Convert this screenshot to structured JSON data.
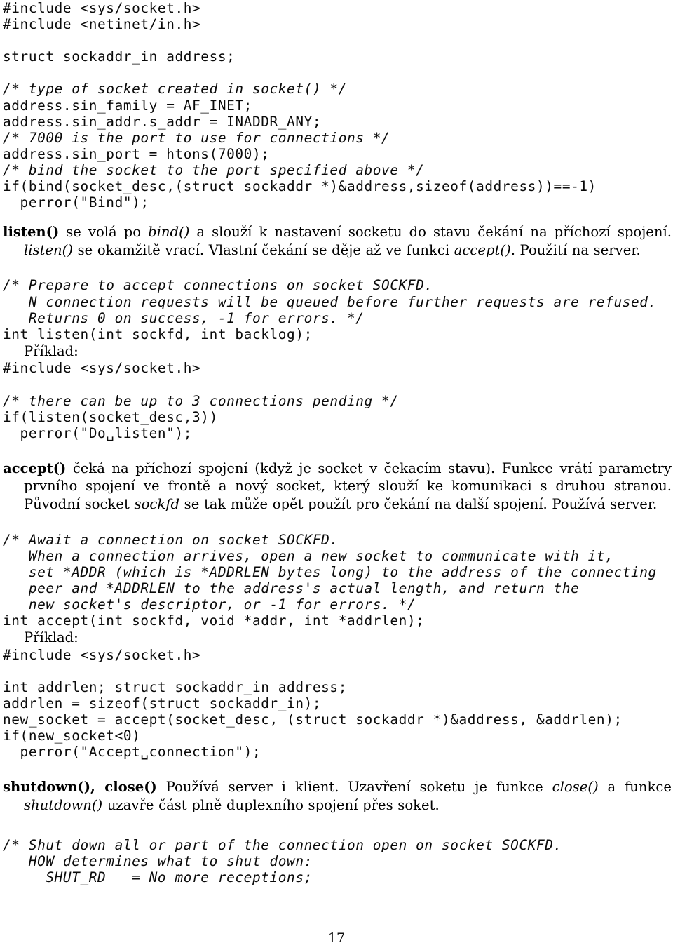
{
  "document": {
    "language": "cs",
    "page_number": "17",
    "topic": "Socket API — listen(), accept(), shutdown(), close()"
  },
  "blocks": {
    "code_bind": {
      "lines": [
        {
          "text": "#include <sys/socket.h>",
          "style": "plain"
        },
        {
          "text": "#include <netinet/in.h>",
          "style": "plain"
        },
        {
          "text": "",
          "style": "blank"
        },
        {
          "text": "struct sockaddr_in address;",
          "style": "plain"
        },
        {
          "text": "",
          "style": "blank"
        },
        {
          "text": "/* type of socket created in socket() */",
          "style": "comment"
        },
        {
          "text": "address.sin_family = AF_INET;",
          "style": "plain"
        },
        {
          "text": "address.sin_addr.s_addr = INADDR_ANY;",
          "style": "plain"
        },
        {
          "text": "/* 7000 is the port to use for connections */",
          "style": "comment"
        },
        {
          "text": "address.sin_port = htons(7000);",
          "style": "plain"
        },
        {
          "text": "/* bind the socket to the port specified above */",
          "style": "comment"
        },
        {
          "text": "if(bind(socket_desc,(struct sockaddr *)&address,sizeof(address))==-1)",
          "style": "plain"
        },
        {
          "text": "  perror(\"Bind\");",
          "style": "plain"
        }
      ]
    },
    "para_listen": {
      "term": "listen()",
      "runs": [
        {
          "text": " se volá po ",
          "style": "plain"
        },
        {
          "text": "bind()",
          "style": "italic"
        },
        {
          "text": " a slouží k nastavení socketu do stavu čekání na příchozí spojení. ",
          "style": "plain"
        },
        {
          "text": "listen()",
          "style": "italic"
        },
        {
          "text": " se okamžitě vrací. Vlastní čekání se děje až ve funkci ",
          "style": "plain"
        },
        {
          "text": "accept()",
          "style": "italic"
        },
        {
          "text": ". Použití na server.",
          "style": "plain"
        }
      ]
    },
    "code_listen_proto": {
      "lines": [
        {
          "text": "/* Prepare to accept connections on socket SOCKFD.",
          "style": "comment"
        },
        {
          "text": "   N connection requests will be queued before further requests are refused.",
          "style": "comment"
        },
        {
          "text": "   Returns 0 on success, -1 for errors. */",
          "style": "comment"
        },
        {
          "text": "int listen(int sockfd, int backlog);",
          "style": "plain"
        }
      ]
    },
    "priklad_listen": {
      "label": "Příklad:"
    },
    "code_listen_example": {
      "lines": [
        {
          "text": "#include <sys/socket.h>",
          "style": "plain"
        },
        {
          "text": "",
          "style": "blank"
        },
        {
          "text": "/* there can be up to 3 connections pending */",
          "style": "comment"
        },
        {
          "text": "if(listen(socket_desc,3))",
          "style": "plain"
        },
        {
          "text": "  perror(\"Do␣listen\");",
          "style": "plain"
        }
      ]
    },
    "para_accept": {
      "term": "accept()",
      "runs": [
        {
          "text": " čeká na příchozí spojení (když je socket v čekacím stavu). Funkce vrátí parametry prvního spojení ve frontě a nový socket, který slouží ke komunikaci s druhou stranou. Původní socket ",
          "style": "plain"
        },
        {
          "text": "sockfd",
          "style": "italic"
        },
        {
          "text": " se tak může opět použít pro čekání na další spojení. Používá server.",
          "style": "plain"
        }
      ]
    },
    "code_accept_proto": {
      "lines": [
        {
          "text": "/* Await a connection on socket SOCKFD.",
          "style": "comment"
        },
        {
          "text": "   When a connection arrives, open a new socket to communicate with it,",
          "style": "comment"
        },
        {
          "text": "   set *ADDR (which is *ADDRLEN bytes long) to the address of the connecting",
          "style": "comment"
        },
        {
          "text": "   peer and *ADDRLEN to the address's actual length, and return the",
          "style": "comment"
        },
        {
          "text": "   new socket's descriptor, or -1 for errors. */",
          "style": "comment"
        },
        {
          "text": "int accept(int sockfd, void *addr, int *addrlen);",
          "style": "plain"
        }
      ]
    },
    "priklad_accept": {
      "label": "Příklad:"
    },
    "code_accept_example": {
      "lines": [
        {
          "text": "#include <sys/socket.h>",
          "style": "plain"
        },
        {
          "text": "",
          "style": "blank"
        },
        {
          "text": "int addrlen; struct sockaddr_in address;",
          "style": "plain"
        },
        {
          "text": "addrlen = sizeof(struct sockaddr_in);",
          "style": "plain"
        },
        {
          "text": "new_socket = accept(socket_desc, (struct sockaddr *)&address, &addrlen);",
          "style": "plain"
        },
        {
          "text": "if(new_socket<0)",
          "style": "plain"
        },
        {
          "text": "  perror(\"Accept␣connection\");",
          "style": "plain"
        }
      ]
    },
    "para_shutdown": {
      "term": "shutdown(), close()",
      "runs": [
        {
          "text": " Používá server i klient. Uzavření soketu je funkce ",
          "style": "plain"
        },
        {
          "text": "close()",
          "style": "italic"
        },
        {
          "text": " a funkce ",
          "style": "plain"
        },
        {
          "text": "shutdown()",
          "style": "italic"
        },
        {
          "text": " uzavře část plně duplexního spojení přes soket.",
          "style": "plain"
        }
      ]
    },
    "code_shutdown": {
      "lines": [
        {
          "text": "/* Shut down all or part of the connection open on socket SOCKFD.",
          "style": "comment"
        },
        {
          "text": "   HOW determines what to shut down:",
          "style": "comment"
        },
        {
          "text": "     SHUT_RD   = No more receptions;",
          "style": "comment"
        }
      ]
    }
  },
  "footer": {
    "page_number": "17"
  }
}
